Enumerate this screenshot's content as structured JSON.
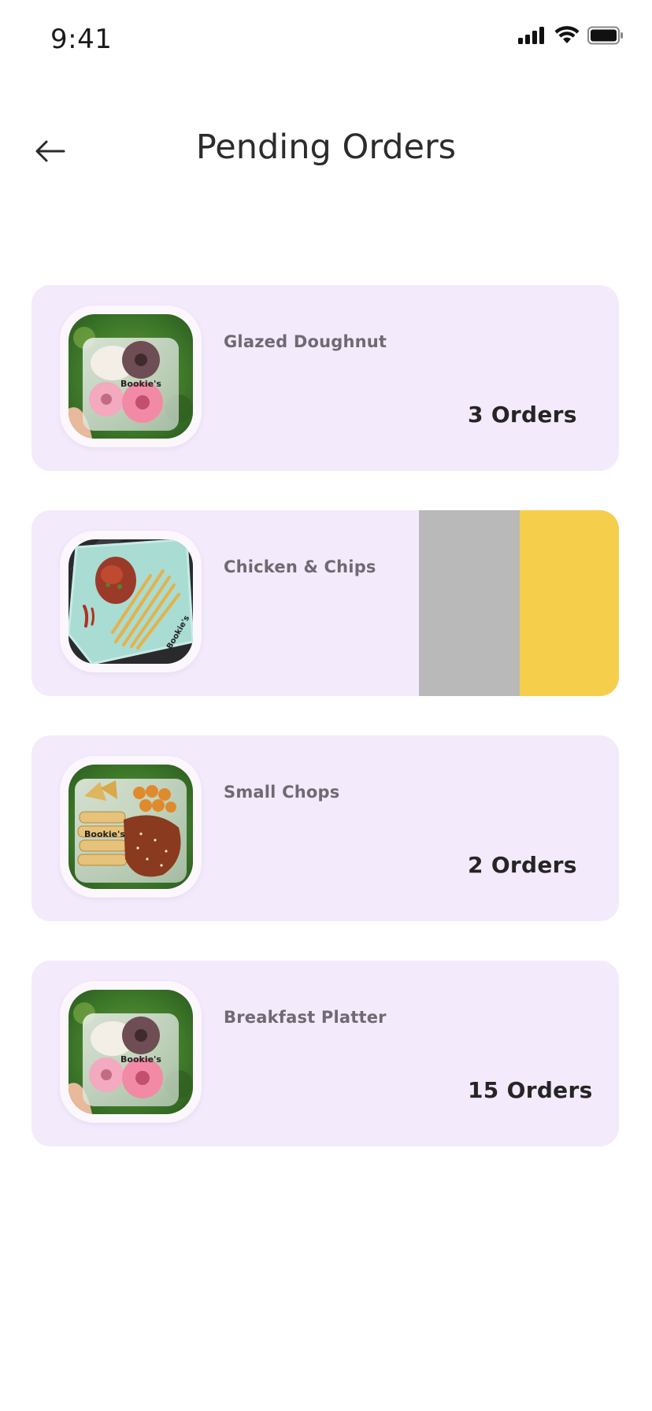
{
  "status_bar": {
    "time": "9:41",
    "icons": [
      "signal-icon",
      "wifi-icon",
      "battery-icon"
    ]
  },
  "header": {
    "title": "Pending Orders",
    "back_icon": "arrow-left-icon"
  },
  "orders": [
    {
      "name": "Glazed Doughnut",
      "count_label": "3 Orders",
      "image": "doughnut-box"
    },
    {
      "name": "Chicken & Chips",
      "count_label": "",
      "image": "chicken-chips-plate",
      "swipe_open": true
    },
    {
      "name": "Small Chops",
      "count_label": "2 Orders",
      "image": "small-chops-box"
    },
    {
      "name": "Breakfast Platter",
      "count_label": "15 Orders",
      "image": "doughnut-box"
    }
  ],
  "colors": {
    "card_background": "#f3eafc",
    "swipe_gray": "#b9b9b9",
    "swipe_yellow": "#f5cf4b",
    "text_primary": "#252525",
    "text_secondary": "#6e6a72"
  }
}
